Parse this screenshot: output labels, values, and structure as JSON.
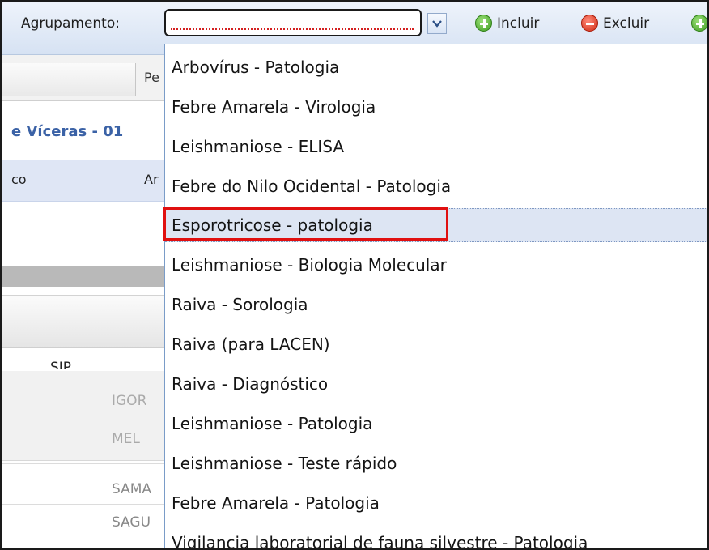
{
  "toolbar": {
    "label": "Agrupamento:",
    "input_value": "",
    "include_label": "Incluir",
    "exclude_label": "Excluir"
  },
  "background": {
    "tab_header_partial": "Pe",
    "section_title_partial": "e Víceras - 01",
    "row_left_partial": "co",
    "row_right_partial": "Ar",
    "sip_partial": "SIP",
    "ghost_rows": [
      "IGOR",
      "MEL",
      "SAMA",
      "SAGU"
    ]
  },
  "dropdown": {
    "selected_index": 4,
    "options": [
      "Arbovírus - Patologia",
      "Febre Amarela - Virologia",
      "Leishmaniose - ELISA",
      "Febre do Nilo Ocidental - Patologia",
      "Esporotricose - patologia",
      "Leishmaniose - Biologia Molecular",
      "Raiva - Sorologia",
      "Raiva (para LACEN)",
      "Raiva - Diagnóstico",
      "Leishmaniose - Patologia",
      "Leishmaniose - Teste rápido",
      "Febre Amarela - Patologia",
      "Vigilancia laboratorial de fauna silvestre - Patologia"
    ]
  },
  "colors": {
    "highlight_border": "#e01010",
    "selected_row_bg": "#dde5f3",
    "section_title": "#3b62a6"
  }
}
